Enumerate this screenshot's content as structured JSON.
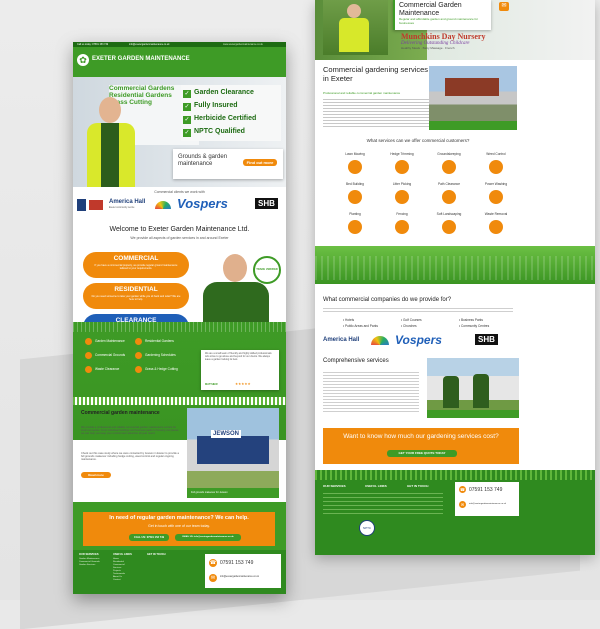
{
  "front": {
    "topbar": {
      "left": "Call us today: 07591 153 749",
      "mid": "info@exetergardenmaintenance.co.uk",
      "right": "www.exetergardenmaintenance.co.uk"
    },
    "brand": "EXETER GARDEN MAINTENANCE",
    "nav": [
      "HOME",
      "RESIDENTIAL GARDENS",
      "COMMERCIAL GROUNDS",
      "GARDEN SERVICES",
      "PROJECTS",
      "TESTIMONIALS",
      "ABOUT US",
      "CONTACT US"
    ],
    "hero": {
      "van_lines": [
        "Commercial Gardens",
        "Residential Gardens",
        "Grass Cutting"
      ],
      "checks": [
        "Garden Clearance",
        "Fully Insured",
        "Herbicide Certified",
        "NPTC Qualified"
      ],
      "card_title": "Grounds & garden maintenance",
      "card_button": "Find out more"
    },
    "clients": {
      "heading": "Commercial clients we work with",
      "logos": [
        "America Hall",
        "Vospers",
        "SHB"
      ],
      "america_sub": "Exeter community centre"
    },
    "welcome": {
      "title": "Welcome to Exeter Garden Maintenance Ltd.",
      "subtitle": "We provide all aspects of garden services in and around Exeter",
      "pills": [
        {
          "title": "COMMERCIAL",
          "text": "If you have a commercial property, we provide regular ground maintenance tailored to your requirements.",
          "color": "#f08a0c"
        },
        {
          "title": "RESIDENTIAL",
          "text": "Do you need someone to take your garden while you sit back and relax? We are here to help.",
          "color": "#f08a0c"
        },
        {
          "title": "CLEARANCE",
          "text": "Is your garden untidy? We offer a complete garden waste clearance to improve the look of your garden.",
          "color": "#1f5fb8"
        }
      ],
      "badge": "TRADE VERIFIED"
    },
    "services": [
      "Garden Maintenance",
      "Residential Gardens",
      "Commercial Grounds",
      "Gardening Schedules",
      "Waste Clearance",
      "Grass & Hedge Cutting"
    ],
    "quote": {
      "text": "We are a small team of friendly and highly skilled professionals who strive to go above and beyond for our clients. We always leave a garden looking its best.",
      "author": "MATTHEW"
    },
    "commercial": {
      "title": "Commercial garden maintenance",
      "p1": "We provide a professional and reliable commercial garden maintenance service for local companies. From individual buildings and business parks to housing complexes, we can help you keep your environment attractive all year round.",
      "p2": "Check out this case study where we were contacted by Jewson in Exeter to provide a full grounds makeover including hedge cutting, weed control and regular ongoing maintenance.",
      "button": "Read more",
      "photo_sign": "JEWSON",
      "photo_caption": "Full grounds makeover for Jewson"
    },
    "cta": {
      "title": "In need of regular garden maintenance? We can help.",
      "subtitle": "Get in touch with one of our team today.",
      "call": "CALL US: 07591 153 749",
      "email": "EMAIL US: info@exetergardenmaintenance.co.uk"
    },
    "footer": {
      "cols": [
        "OUR SERVICES",
        "USEFUL LINKS",
        "GET IN TOUCH"
      ],
      "services": [
        "Garden Maintenance",
        "Commercial Grounds",
        "Garden Services"
      ],
      "links": [
        "Home",
        "Residential",
        "Commercial",
        "Services",
        "Projects",
        "Testimonials",
        "About Us",
        "Contact"
      ],
      "phone": "07591 153 749",
      "email": "info@exetergardenmaintenance.co.uk"
    }
  },
  "back": {
    "hero_title": "Commercial Garden Maintenance",
    "hero_sub": "Regular and affordable garden and ground maintenance for businesses",
    "nursery": {
      "name": "Munchkins Day Nursery",
      "tag": "Delivering Outstanding Childcare",
      "foot": "Healthy Meals · Baby Massage · French"
    },
    "intro_title": "Commercial gardening services in Exeter",
    "intro_sub": "Professional and reliable commercial garden maintenance",
    "services_heading": "What services can we offer commercial customers?",
    "services": [
      "Lawn Mowing",
      "Hedge Trimming",
      "Groundskeeping",
      "Weed Control",
      "Bed Building",
      "Litter Picking",
      "Path Clearance",
      "Power Washing",
      "Planting",
      "Fencing",
      "Soft Landscaping",
      "Waste Removal"
    ],
    "provide_title": "What commercial companies do we provide for?",
    "provide_cols": [
      [
        "Hotels",
        "Public Areas and Parks"
      ],
      [
        "Golf Courses",
        "Churches"
      ],
      [
        "Business Parks",
        "Community Centres"
      ]
    ],
    "logos": [
      "America Hall",
      "Vospers",
      "SHB"
    ],
    "comp_title": "Comprehensive services",
    "cta_title": "Want to know how much our gardening services cost?",
    "cta_button": "GET YOUR FREE QUOTE TODAY",
    "footer": {
      "cols": [
        "OUR SERVICES",
        "USEFUL LINKS",
        "GET IN TOUCH"
      ],
      "phone": "07591 153 749",
      "email": "info@exetergardenmaintenance.co.uk",
      "badge": "NPTC"
    }
  },
  "colors": {
    "green": "#3e9b26",
    "orange": "#f08a0c",
    "blue": "#1f5fb8",
    "footer": "#2f8a1f"
  }
}
